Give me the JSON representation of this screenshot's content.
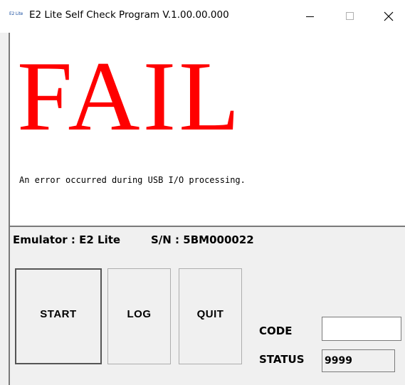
{
  "window": {
    "icon_text": "E2 Lite",
    "title": "E2 Lite Self Check Program V.1.00.00.000",
    "controls": {
      "minimize": "minimize-icon",
      "maximize": "maximize-icon",
      "close": "close-icon"
    }
  },
  "display": {
    "result": "FAIL",
    "result_color": "#ff0000",
    "message": "An error occurred during USB I/O processing."
  },
  "info": {
    "emulator": "Emulator : E2 Lite",
    "serial": "S/N : 5BM000022"
  },
  "buttons": {
    "start": "START",
    "log": "LOG",
    "quit": "QUIT"
  },
  "fields": {
    "code_label": "CODE",
    "code_value": "",
    "status_label": "STATUS",
    "status_value": "9999"
  }
}
